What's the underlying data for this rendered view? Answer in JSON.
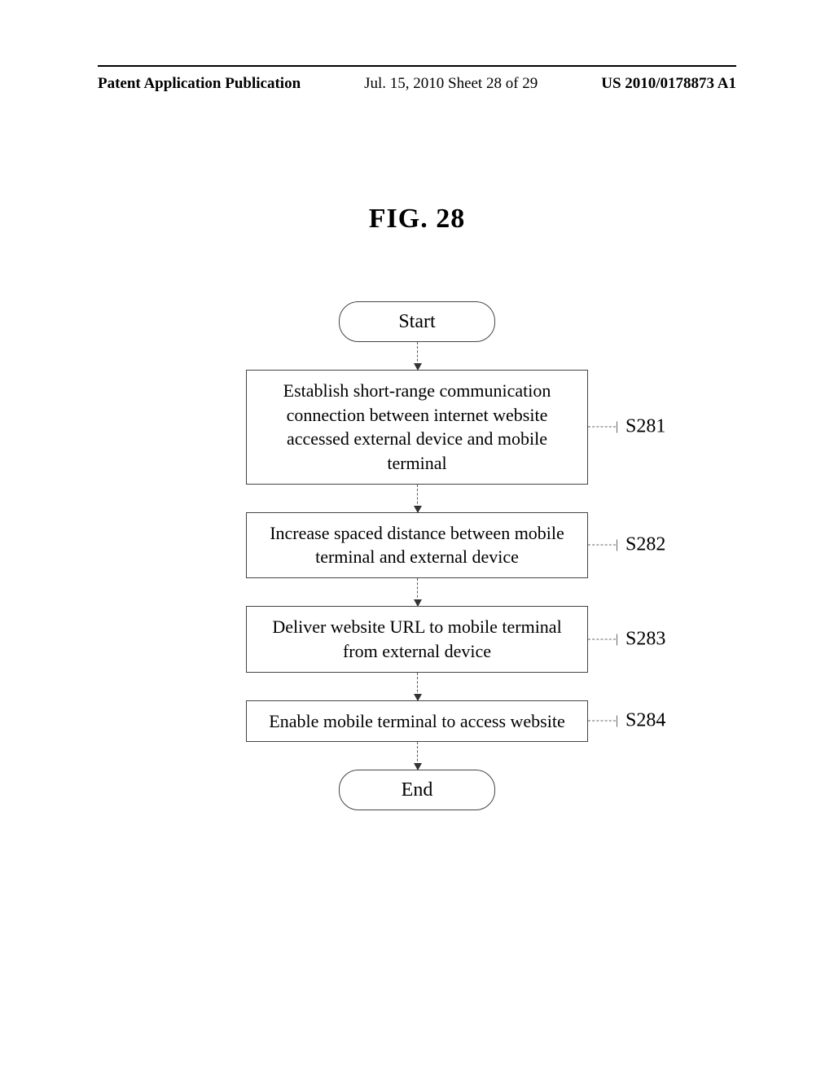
{
  "header": {
    "left": "Patent Application Publication",
    "center": "Jul. 15, 2010  Sheet 28 of 29",
    "right": "US 2010/0178873 A1"
  },
  "figure_title": "FIG. 28",
  "flow": {
    "start": "Start",
    "end": "End",
    "steps": [
      {
        "id": "S281",
        "text": "Establish short-range communication connection between internet website accessed external device and mobile terminal"
      },
      {
        "id": "S282",
        "text": "Increase spaced distance between mobile terminal and external device"
      },
      {
        "id": "S283",
        "text": "Deliver website URL to mobile terminal from external device"
      },
      {
        "id": "S284",
        "text": "Enable mobile terminal to access website"
      }
    ]
  }
}
